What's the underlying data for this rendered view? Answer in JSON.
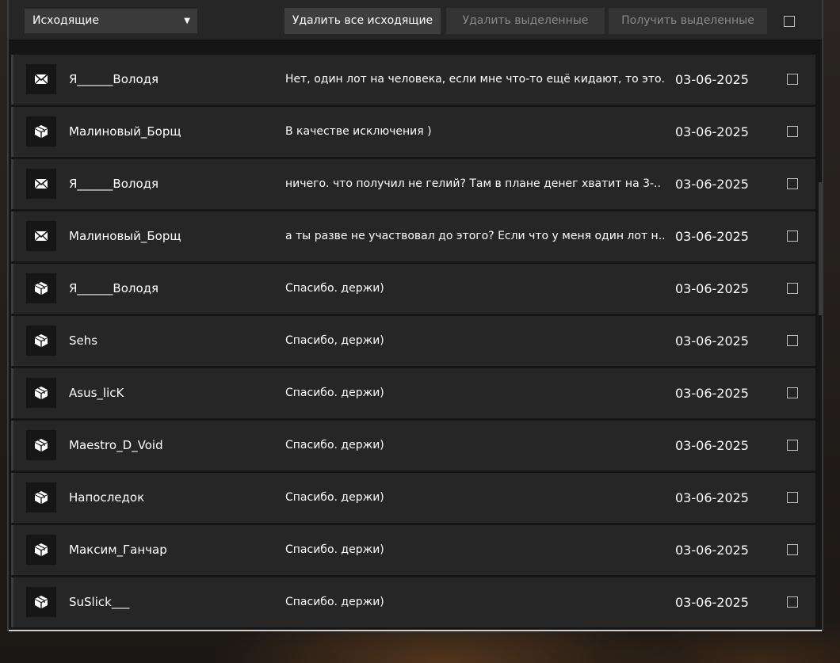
{
  "toolbar": {
    "filter": {
      "selected": "Исходящие"
    },
    "delete_all_label": "Удалить все исходящие",
    "delete_selected_label": "Удалить выделенные",
    "receive_selected_label": "Получить выделенные"
  },
  "messages": [
    {
      "icon": "envelope-icon",
      "sender": "Я______Володя",
      "text": "Нет, один лот на человека, если мне что-то ещё кидают, то это..",
      "date": "03-06-2025"
    },
    {
      "icon": "package-icon",
      "sender": "Малиновый_Борщ",
      "text": "В качестве исключения )",
      "date": "03-06-2025"
    },
    {
      "icon": "envelope-icon",
      "sender": "Я______Володя",
      "text": "ничего. что получил не гелий? Там в плане денег хватит на 3-..",
      "date": "03-06-2025"
    },
    {
      "icon": "envelope-icon",
      "sender": "Малиновый_Борщ",
      "text": "а ты разве не участвовал до этого? Если что у меня один лот н..",
      "date": "03-06-2025"
    },
    {
      "icon": "package-icon",
      "sender": "Я______Володя",
      "text": "Спасибо. держи)",
      "date": "03-06-2025"
    },
    {
      "icon": "package-icon",
      "sender": "Sehs",
      "text": "Спасибо, держи)",
      "date": "03-06-2025"
    },
    {
      "icon": "package-icon",
      "sender": "Asus_licK",
      "text": "Спасибо. держи)",
      "date": "03-06-2025"
    },
    {
      "icon": "package-icon",
      "sender": "Maestro_D_Void",
      "text": "Спасибо. держи)",
      "date": "03-06-2025"
    },
    {
      "icon": "package-icon",
      "sender": "Напоследок",
      "text": "Спасибо. держи)",
      "date": "03-06-2025"
    },
    {
      "icon": "package-icon",
      "sender": "Максим_Ганчар",
      "text": "Спасибо. держи)",
      "date": "03-06-2025"
    },
    {
      "icon": "package-icon",
      "sender": "SuSlick___",
      "text": "Спасибо. держи)",
      "date": "03-06-2025"
    }
  ]
}
